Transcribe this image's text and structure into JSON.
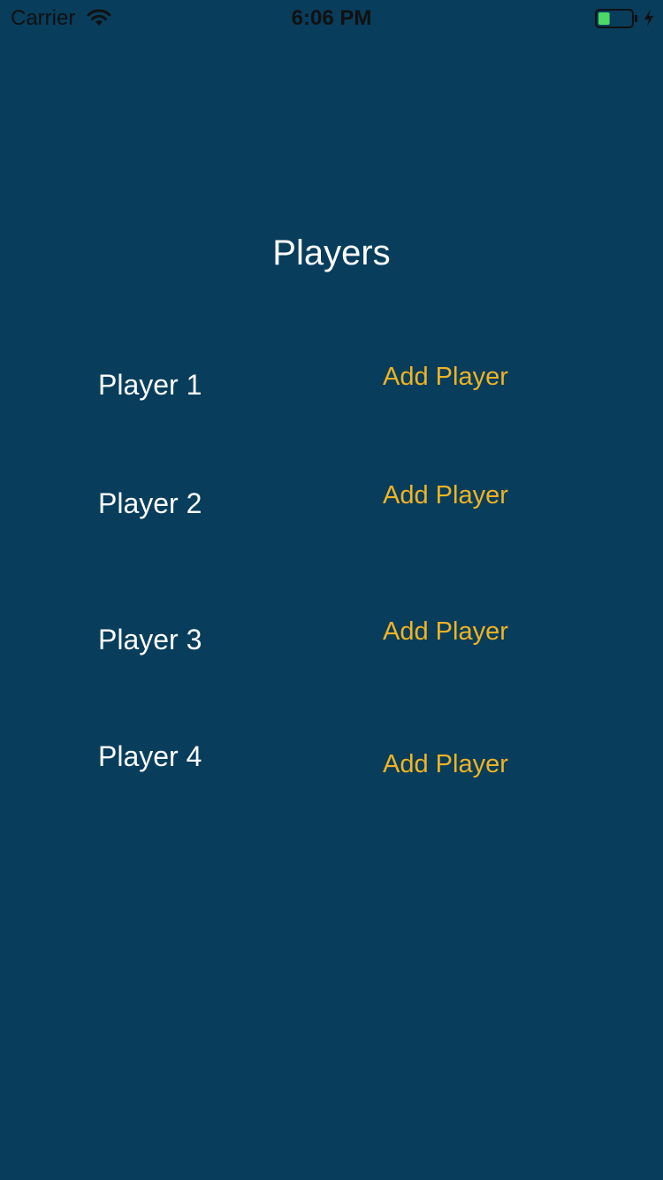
{
  "status_bar": {
    "carrier": "Carrier",
    "time": "6:06 PM",
    "wifi_icon": "wifi-icon",
    "battery_icon": "battery-icon",
    "battery_level": 0.35,
    "battery_color": "#4cd964",
    "charging_icon": "bolt-icon"
  },
  "page": {
    "title": "Players",
    "background_color": "#083d5c",
    "accent_color": "#f0b323"
  },
  "players": [
    {
      "label": "Player 1",
      "button_label": "Add Player"
    },
    {
      "label": "Player 2",
      "button_label": "Add Player"
    },
    {
      "label": "Player 3",
      "button_label": "Add Player"
    },
    {
      "label": "Player 4",
      "button_label": "Add Player"
    }
  ]
}
